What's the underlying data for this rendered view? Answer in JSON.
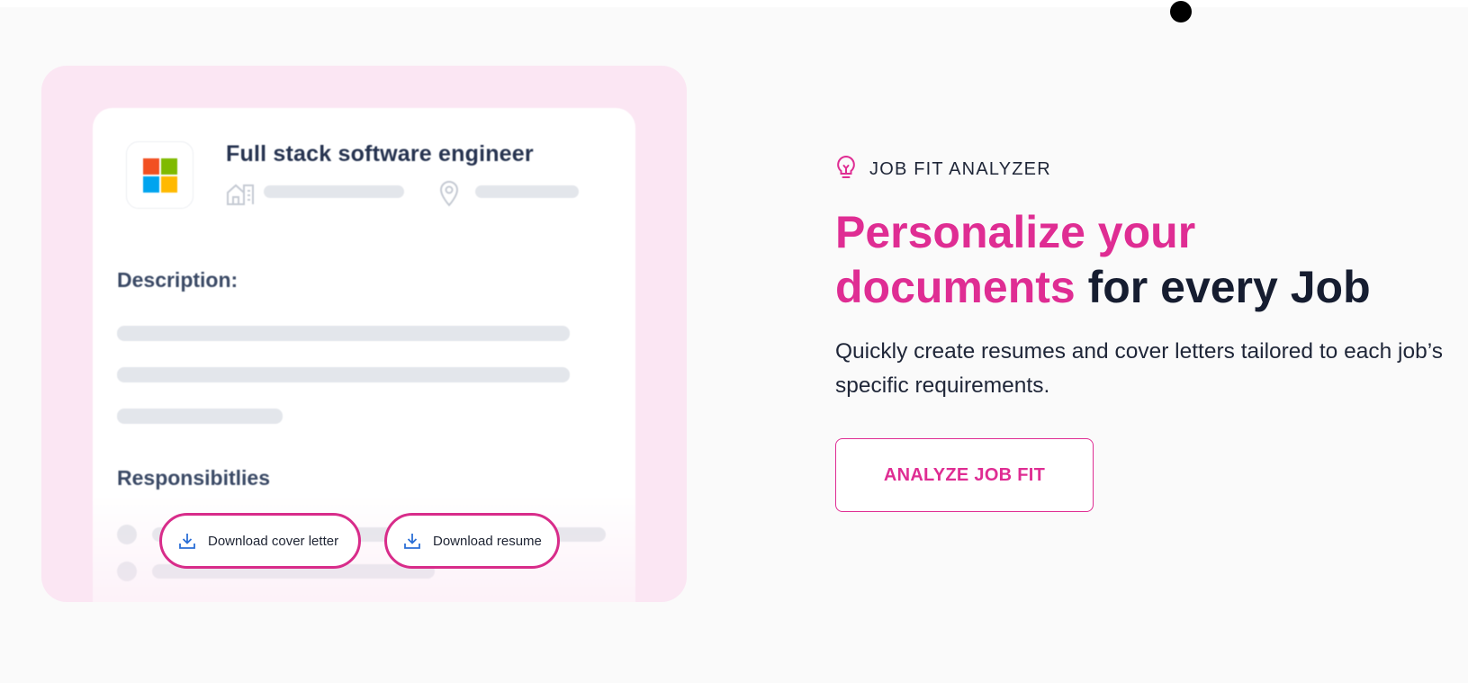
{
  "illustration": {
    "job_title": "Full stack software engineer",
    "description_heading": "Description:",
    "responsibilities_heading": "Responsibitlies",
    "logo_colors": [
      "#f25022",
      "#7fba00",
      "#00a4ef",
      "#ffb900"
    ],
    "buttons": {
      "cover_letter": "Download cover letter",
      "resume": "Download resume"
    }
  },
  "hero": {
    "eyebrow": "JOB FIT ANALYZER",
    "headline_pink_line1": "Personalize your",
    "headline_pink_line2": "documents",
    "headline_dark": " for every Job",
    "subtext": "Quickly create resumes and cover letters tailored to each job’s specific requirements.",
    "cta_label": "ANALYZE JOB FIT"
  },
  "colors": {
    "accent": "#df2d93",
    "panel_bg": "#fbe6f3",
    "text_dark": "#161d30"
  },
  "icons": [
    "bulb-icon",
    "building-icon",
    "location-pin-icon",
    "download-icon",
    "microsoft-logo"
  ]
}
